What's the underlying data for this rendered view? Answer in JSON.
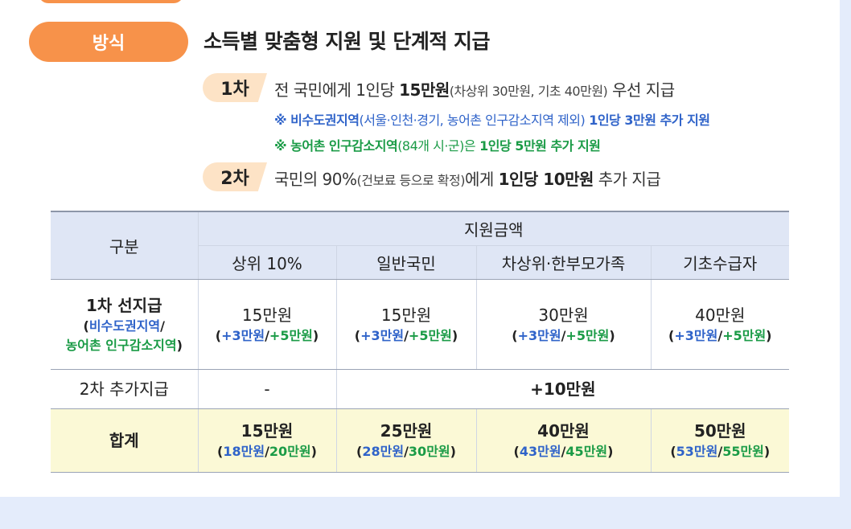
{
  "method": {
    "label": "방식",
    "headline": "소득별 맞춤형 지원 및 단계적 지급"
  },
  "step1": {
    "badge": "1차",
    "text_a": "전 국민에게 1인당 ",
    "text_b": "15만원",
    "text_c": "(차상위 30만원, 기초 40만원)",
    "text_d": " 우선 지급",
    "note1_a": "※ 비수도권지역",
    "note1_b": "(서울·인천·경기, 농어촌 인구감소지역 제외)",
    "note1_c": " 1인당 3만원 추가 지원",
    "note2_a": "※ 농어촌 인구감소지역",
    "note2_b": "(84개 시·군)은",
    "note2_c": " 1인당 5만원 추가 지원"
  },
  "step2": {
    "badge": "2차",
    "text_a": "국민의 90%",
    "text_b": "(건보료 등으로 확정)",
    "text_c": "에게 ",
    "text_d": "1인당 10만원",
    "text_e": " 추가 지급"
  },
  "table": {
    "col_category": "구분",
    "col_amount": "지원금액",
    "groups": [
      "상위 10%",
      "일반국민",
      "차상위·한부모가족",
      "기초수급자"
    ],
    "row1": {
      "label": "1차 선지급",
      "sub_open": "(",
      "sub_blue": "비수도권지역",
      "sub_slash": "/",
      "sub_green": "농어촌 인구감소지역",
      "sub_close": ")",
      "values": [
        "15만원",
        "15만원",
        "30만원",
        "40만원"
      ],
      "extra_open": "(",
      "extra_blue": "+3만원",
      "extra_slash": "/",
      "extra_green": "+5만원",
      "extra_close": ")"
    },
    "row2": {
      "label": "2차 추가지급",
      "first": "-",
      "rest": "+10만원"
    },
    "total": {
      "label": "합계",
      "cells": [
        {
          "main": "15만원",
          "blue": "18만원",
          "green": "20만원"
        },
        {
          "main": "25만원",
          "blue": "28만원",
          "green": "30만원"
        },
        {
          "main": "40만원",
          "blue": "43만원",
          "green": "45만원"
        },
        {
          "main": "50만원",
          "blue": "53만원",
          "green": "55만원"
        }
      ]
    }
  },
  "colors": {
    "accent_orange": "#f7924a",
    "badge_peach": "#fde3c6",
    "note_blue": "#2f63c9",
    "note_green": "#1a9b46",
    "header_bg": "#dfe6f5",
    "total_bg": "#fbf9d6",
    "page_bg": "#e4ecfb"
  }
}
